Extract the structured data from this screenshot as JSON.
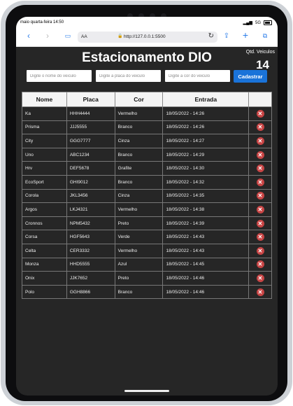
{
  "status": {
    "time": "maio quarta-feira 14:50",
    "signal": "5G"
  },
  "browser": {
    "aa": "AA",
    "url": "http://127.0.0.1:5500"
  },
  "page": {
    "title": "Estacionamento DIO",
    "qtd_label": "Qtd. Veiculos",
    "qtd_value": "14"
  },
  "form": {
    "nome_placeholder": "Digite o nome do veiculo",
    "placa_placeholder": "Digite a placa do veiculo",
    "cor_placeholder": "Digite a cor do veiculo",
    "submit_label": "Cadastrar"
  },
  "table": {
    "headers": [
      "Nome",
      "Placa",
      "Cor",
      "Entrada",
      ""
    ],
    "delete_symbol": "✕",
    "rows": [
      [
        "Ka",
        "HHH4444",
        "Vermelho",
        "18/05/2022 - 14:26"
      ],
      [
        "Prisma",
        "JJJ5555",
        "Branco",
        "18/05/2022 - 14:26"
      ],
      [
        "City",
        "GGG7777",
        "Cinza",
        "18/05/2022 - 14:27"
      ],
      [
        "Uno",
        "ABC1234",
        "Branco",
        "18/05/2022 - 14:29"
      ],
      [
        "Hrv",
        "DEF5678",
        "Grafite",
        "18/05/2022 - 14:30"
      ],
      [
        "EcoSport",
        "GHI9012",
        "Branco",
        "18/05/2022 - 14:32"
      ],
      [
        "Corola",
        "JKL3456",
        "Cinza",
        "18/05/2022 - 14:35"
      ],
      [
        "Argos",
        "LKJ4321",
        "Vermelho",
        "18/05/2022 - 14:38"
      ],
      [
        "Cronnos",
        "NPM5432",
        "Preto",
        "18/05/2022 - 14:39"
      ],
      [
        "Corsa",
        "HGF5643",
        "Verde",
        "18/05/2022 - 14:43"
      ],
      [
        "Celta",
        "CER3332",
        "Vermelho",
        "18/05/2022 - 14:43"
      ],
      [
        "Monza",
        "HHD5555",
        "Azul",
        "18/05/2022 - 14:45"
      ],
      [
        "Onix",
        "JJK7652",
        "Preto",
        "18/05/2022 - 14:46"
      ],
      [
        "Polo",
        "GGH8866",
        "Branco",
        "18/05/2022 - 14:46"
      ]
    ]
  },
  "colors": {
    "accent": "#1a73d9",
    "delete": "#c94545",
    "background": "#262626"
  }
}
